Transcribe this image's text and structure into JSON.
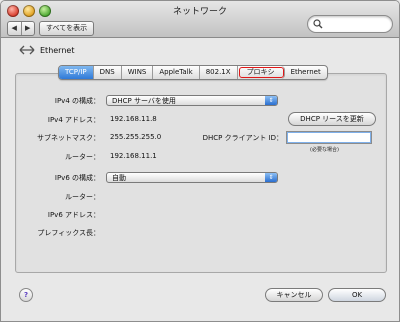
{
  "window": {
    "title": "ネットワーク"
  },
  "toolbar": {
    "back": "◀",
    "forward": "▶",
    "show_all": "すべてを表示",
    "search_placeholder": ""
  },
  "header": {
    "service": "Ethernet"
  },
  "tabs": [
    {
      "label": "TCP/IP",
      "active": true
    },
    {
      "label": "DNS"
    },
    {
      "label": "WINS"
    },
    {
      "label": "AppleTalk"
    },
    {
      "label": "802.1X"
    },
    {
      "label": "プロキシ",
      "highlighted": true
    },
    {
      "label": "Ethernet"
    }
  ],
  "ipv4": {
    "config_label": "IPv4 の構成：",
    "config_value": "DHCP サーバを使用",
    "address_label": "IPv4 アドレス：",
    "address_value": "192.168.11.8",
    "renew_button": "DHCP リースを更新",
    "subnet_label": "サブネットマスク：",
    "subnet_value": "255.255.255.0",
    "client_id_label": "DHCP クライアント ID：",
    "client_id_value": "",
    "client_id_note": "(必要な場合)",
    "router_label": "ルーター：",
    "router_value": "192.168.11.1"
  },
  "ipv6": {
    "config_label": "IPv6 の構成：",
    "config_value": "自動",
    "router_label": "ルーター：",
    "address_label": "IPv6 アドレス：",
    "prefix_label": "プレフィックス長："
  },
  "footer": {
    "help": "?",
    "cancel": "キャンセル",
    "ok": "OK"
  }
}
